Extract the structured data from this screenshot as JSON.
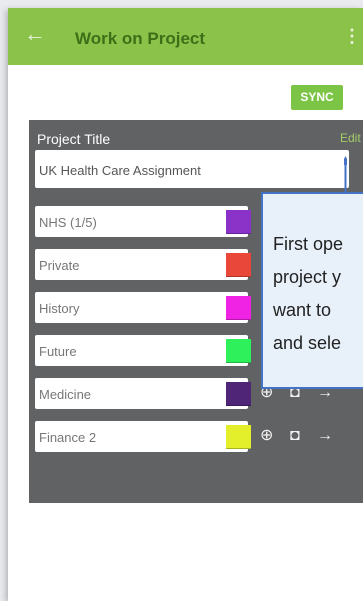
{
  "app": {
    "title": "Work on Project",
    "back_icon": "back-arrow-icon",
    "menu_icon": "more-vert-icon"
  },
  "toolbar": {
    "sync_label": "SYNC"
  },
  "project": {
    "header_label": "Project Title",
    "edit_label": "Edit",
    "title_value": "UK Health Care Assignment"
  },
  "sections": [
    {
      "label": "NHS (1/5)",
      "color": "#8b32c8"
    },
    {
      "label": "Private",
      "color": "#e8473a"
    },
    {
      "label": "History",
      "color": "#f022e3"
    },
    {
      "label": "Future",
      "color": "#2ef05a"
    },
    {
      "label": "Medicine",
      "color": "#4e2577",
      "icons": [
        "globe-icon",
        "camera-icon",
        "arrow-right-icon"
      ]
    },
    {
      "label": "Finance 2",
      "color": "#e2ef2a",
      "icons": [
        "globe-icon",
        "camera-icon",
        "arrow-right-icon"
      ]
    }
  ],
  "callout": {
    "lines": [
      "First ope",
      "project y",
      "want to",
      "and sele"
    ]
  },
  "colors": {
    "accent": "#8bc34a",
    "panel": "#616264",
    "callout_border": "#4472c4"
  }
}
